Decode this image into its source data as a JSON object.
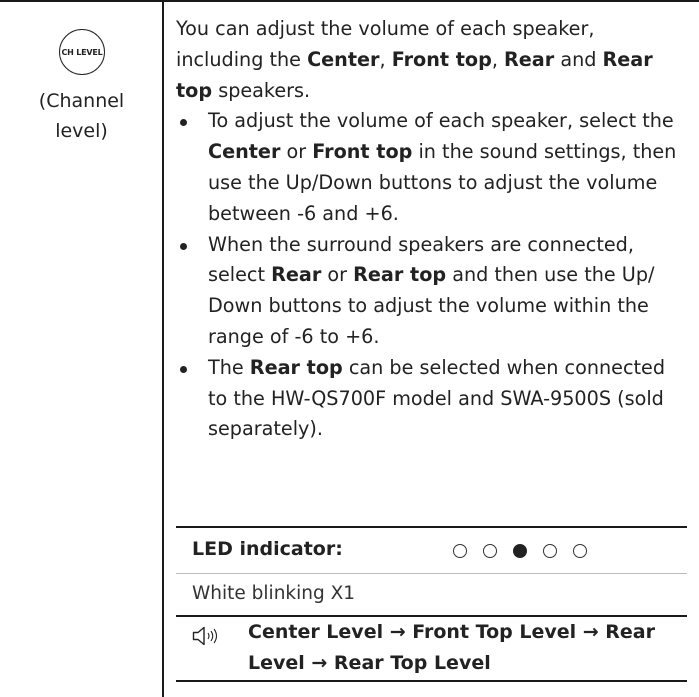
{
  "left": {
    "icon_text": "CH LEVEL",
    "caption_line1": "(Channel",
    "caption_line2": "level)"
  },
  "intro": {
    "t1": "You can adjust the volume of each speaker, including the ",
    "b1": "Center",
    "t2": ", ",
    "b2": "Front top",
    "t3": ", ",
    "b3": "Rear",
    "t4": " and ",
    "b4": "Rear top",
    "t5": " speakers."
  },
  "bullets": [
    {
      "t1": "To adjust the volume of each speaker, select the ",
      "b1": "Center",
      "t2": " or ",
      "b2": "Front top",
      "t3": " in the sound settings, then use the Up/Down buttons to adjust the volume between -6 and +6."
    },
    {
      "t1": "When the surround speakers are connected, select ",
      "b1": "Rear",
      "t2": " or ",
      "b2": "Rear top",
      "t3": " and then use the Up/ Down buttons to adjust the volume within the range of -6 to +6."
    },
    {
      "t1": "The ",
      "b1": "Rear top",
      "t2": " can be selected when connected to the HW-QS700F model and SWA-9500S (sold separately)."
    }
  ],
  "led": {
    "label": "LED indicator:",
    "dots": [
      false,
      false,
      true,
      false,
      false
    ],
    "status": "White blinking X1",
    "sequence": "Center Level → Front Top Level → Rear Level → Rear Top Level"
  },
  "colors": {
    "text": "#222222",
    "rule": "#1a1a1a"
  }
}
